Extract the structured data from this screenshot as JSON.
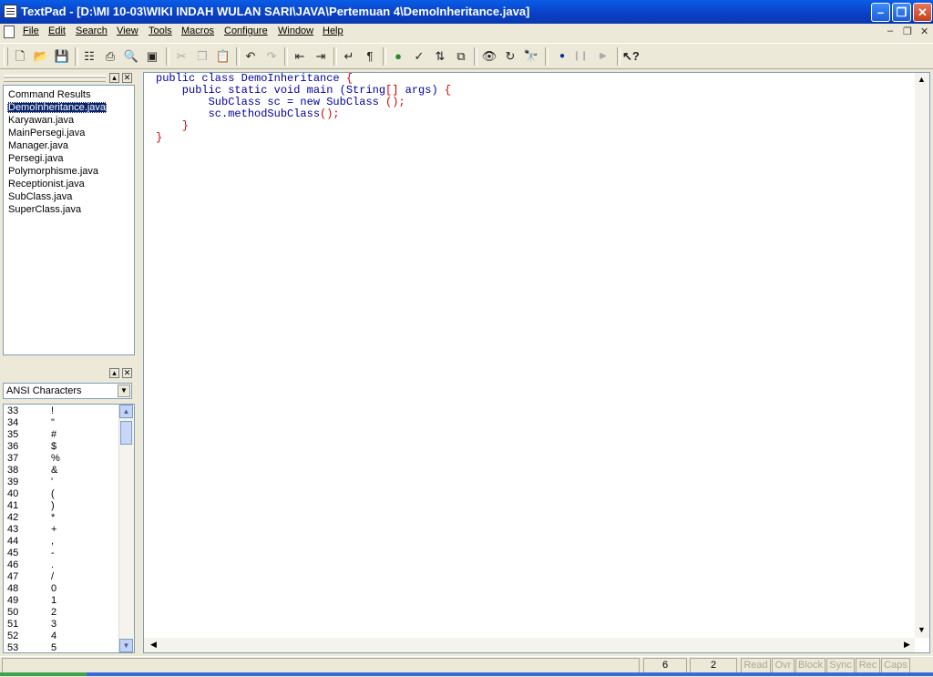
{
  "window": {
    "title": "TextPad - [D:\\MI 10-03\\WIKI INDAH WULAN SARI\\JAVA\\Pertemuan 4\\DemoInheritance.java]"
  },
  "menu": [
    "File",
    "Edit",
    "Search",
    "View",
    "Tools",
    "Macros",
    "Configure",
    "Window",
    "Help"
  ],
  "documents": {
    "items": [
      "Command Results",
      "DemoInheritance.java",
      "Karyawan.java",
      "MainPersegi.java",
      "Manager.java",
      "Persegi.java",
      "Polymorphisme.java",
      "Receptionist.java",
      "SubClass.java",
      "SuperClass.java"
    ],
    "selected_index": 1
  },
  "clip_library": {
    "selected": "ANSI Characters",
    "rows": [
      [
        "33",
        "!"
      ],
      [
        "34",
        "\""
      ],
      [
        "35",
        "#"
      ],
      [
        "36",
        "$"
      ],
      [
        "37",
        "%"
      ],
      [
        "38",
        "&"
      ],
      [
        "39",
        "'"
      ],
      [
        "40",
        "("
      ],
      [
        "41",
        ")"
      ],
      [
        "42",
        "*"
      ],
      [
        "43",
        "+"
      ],
      [
        "44",
        ","
      ],
      [
        "45",
        "-"
      ],
      [
        "46",
        "."
      ],
      [
        "47",
        "/"
      ],
      [
        "48",
        "0"
      ],
      [
        "49",
        "1"
      ],
      [
        "50",
        "2"
      ],
      [
        "51",
        "3"
      ],
      [
        "52",
        "4"
      ],
      [
        "53",
        "5"
      ]
    ]
  },
  "editor": {
    "lines": [
      [
        [
          "kw",
          "public class DemoInheritance "
        ],
        [
          "br",
          "{"
        ]
      ],
      [
        [
          "kw",
          "    public static void main (String"
        ],
        [
          "br",
          "[]"
        ],
        [
          "kw",
          " args) "
        ],
        [
          "br",
          "{"
        ]
      ],
      [
        [
          "kw",
          "        SubClass sc = new SubClass "
        ],
        [
          "br",
          "();"
        ]
      ],
      [
        [
          "kw",
          "        sc.methodSubClass"
        ],
        [
          "br",
          "();"
        ]
      ],
      [
        [
          "br",
          "    }"
        ]
      ],
      [
        [
          "br",
          "}"
        ]
      ]
    ]
  },
  "status": {
    "line": "6",
    "column": "2",
    "indicators": [
      "Read",
      "Ovr",
      "Block",
      "Sync",
      "Rec",
      "Caps"
    ]
  },
  "colors": {
    "keyword": "#0000a0",
    "bracket": "#d00000",
    "selection": "#0a246a"
  }
}
